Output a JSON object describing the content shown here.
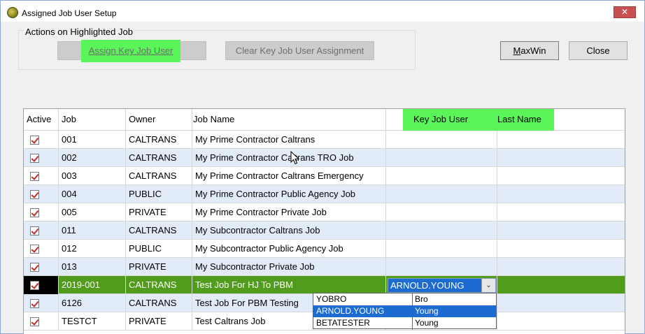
{
  "window": {
    "title": "Assigned Job User Setup",
    "close_glyph": "✕"
  },
  "actions_group": {
    "label": "Actions on Highlighted Job",
    "assign_button": "Assign Key Job User",
    "clear_button": "Clear Key Job User Assignment"
  },
  "toolbar": {
    "maxwin_prefix": "M",
    "maxwin_rest": "axWin",
    "close_button": "Close"
  },
  "table": {
    "headers": {
      "active": "Active",
      "job": "Job",
      "owner": "Owner",
      "job_name": "Job Name",
      "key_job_user": "Key Job User",
      "last_name": "Last Name"
    },
    "rows": [
      {
        "job": "001",
        "owner": "CALTRANS",
        "name": "My Prime Contractor Caltrans",
        "key_user": "",
        "last_name": ""
      },
      {
        "job": "002",
        "owner": "CALTRANS",
        "name": "My Prime Contractor Caltrans TRO Job",
        "key_user": "",
        "last_name": ""
      },
      {
        "job": "003",
        "owner": "CALTRANS",
        "name": "My Prime Contractor Caltrans Emergency",
        "key_user": "",
        "last_name": ""
      },
      {
        "job": "004",
        "owner": "PUBLIC",
        "name": "My Prime Contractor Public Agency Job",
        "key_user": "",
        "last_name": ""
      },
      {
        "job": "005",
        "owner": "PRIVATE",
        "name": "My Prime Contractor Private Job",
        "key_user": "",
        "last_name": ""
      },
      {
        "job": "011",
        "owner": "CALTRANS",
        "name": "My Subcontractor Caltrans Job",
        "key_user": "",
        "last_name": ""
      },
      {
        "job": "012",
        "owner": "PUBLIC",
        "name": "My Subcontractor Public Agency Job",
        "key_user": "",
        "last_name": ""
      },
      {
        "job": "013",
        "owner": "PRIVATE",
        "name": "My Subcontractor Private Job",
        "key_user": "",
        "last_name": ""
      },
      {
        "job": "2019-001",
        "owner": "CALTRANS",
        "name": "Test Job For HJ To PBM",
        "key_user": "ARNOLD.YOUNG",
        "last_name": ""
      },
      {
        "job": "6126",
        "owner": "CALTRANS",
        "name": "Test Job For PBM Testing",
        "key_user": "",
        "last_name": ""
      },
      {
        "job": "TESTCT",
        "owner": "PRIVATE",
        "name": "Test Caltrans Job",
        "key_user": "",
        "last_name": ""
      }
    ],
    "selected_row_index": 8
  },
  "key_user_dropdown": {
    "options": [
      {
        "user": "YOBRO",
        "last": "Bro"
      },
      {
        "user": "ARNOLD.YOUNG",
        "last": "Young"
      },
      {
        "user": "BETATESTER",
        "last": "Young"
      }
    ],
    "selected_index": 1,
    "arrow_glyph": "⌄"
  },
  "colors": {
    "highlight": "#59f559",
    "selected_row": "#529c1d",
    "selection_blue": "#1c6bd1"
  }
}
